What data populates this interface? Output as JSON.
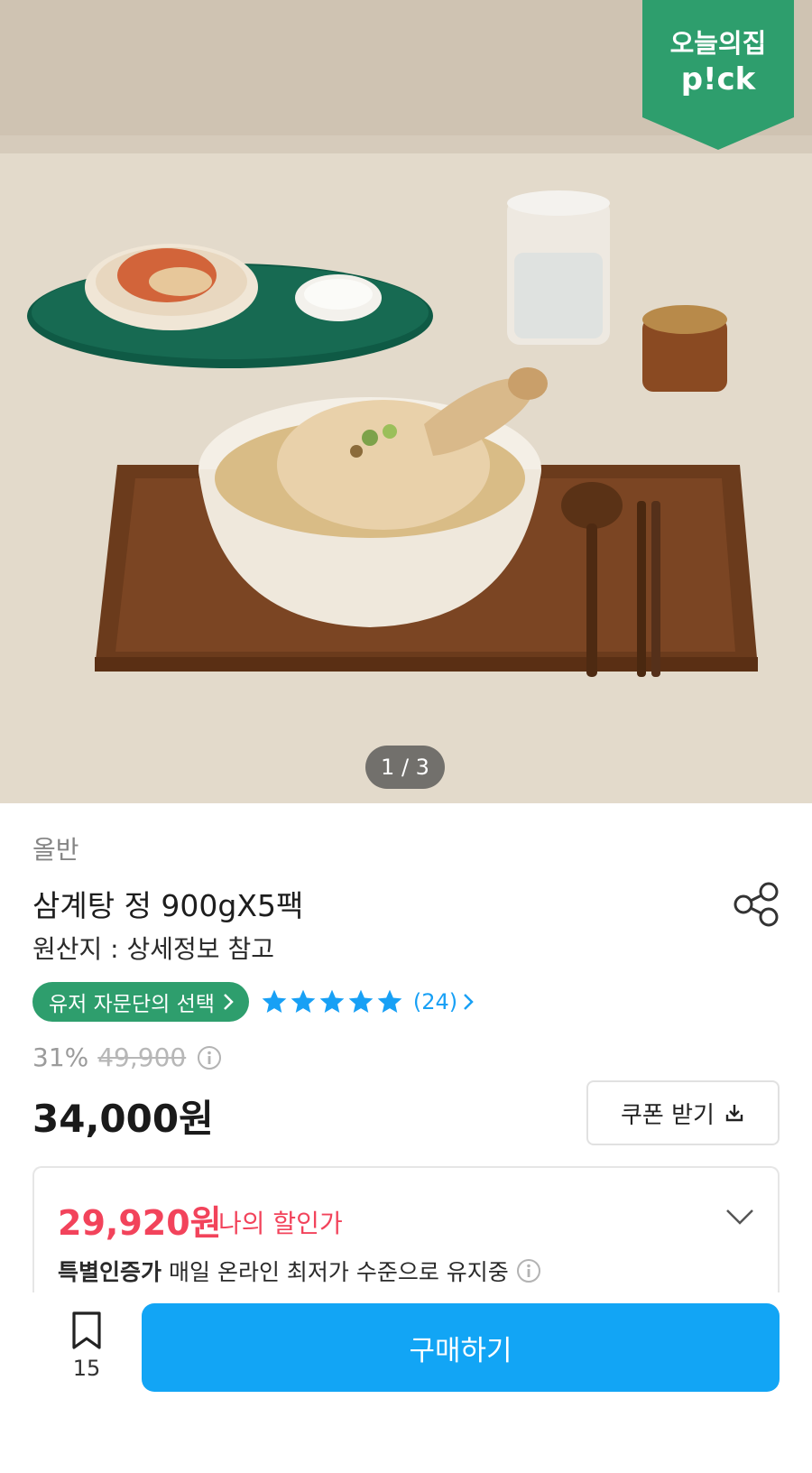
{
  "hero": {
    "badge_line1": "오늘의집",
    "badge_line2": "p!ck",
    "image_counter": "1 / 3",
    "badge_color": "#2e9e6d"
  },
  "product": {
    "brand": "올반",
    "title": "삼계탕 정 900gX5팩",
    "origin": "원산지 : 상세정보 참고",
    "share_icon": "share-icon"
  },
  "badges": {
    "pick_label": "유저 자문단의 선택",
    "rating_stars": 5,
    "review_count": "(24)",
    "star_color": "#18a0f5"
  },
  "pricing": {
    "discount_rate": "31%",
    "original_price": "49,900",
    "sale_price": "34,000원",
    "coupon_label": "쿠폰 받기"
  },
  "my_discount": {
    "price": "29,920원",
    "label": "나의 할인가",
    "note_bold": "특별인증가",
    "note_text": "매일 온라인 최저가 수준으로 유지중",
    "accent_color": "#f2435b"
  },
  "bottom_bar": {
    "bookmark_count": "15",
    "buy_label": "구매하기",
    "buy_color": "#12a5f5"
  }
}
